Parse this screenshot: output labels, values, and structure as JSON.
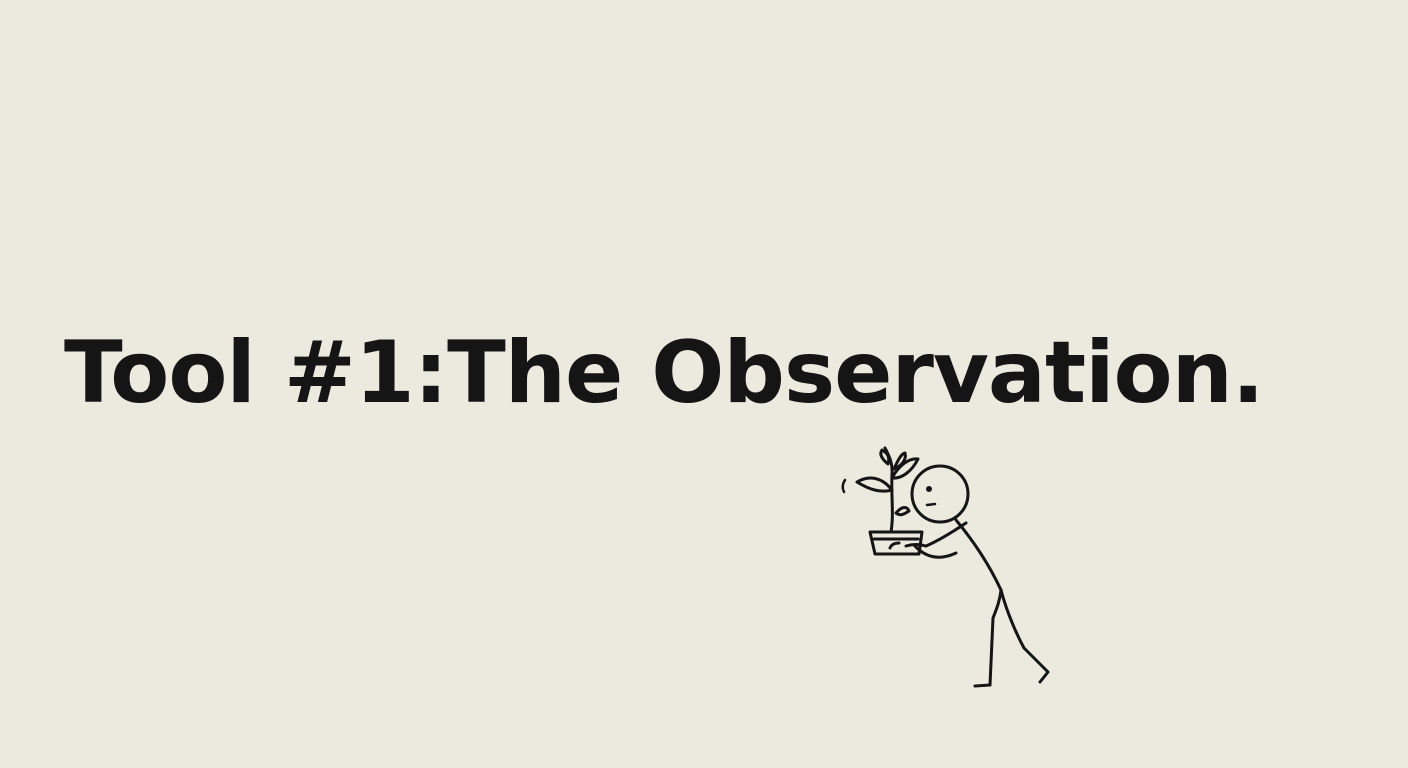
{
  "slide": {
    "title": "Tool #1:The Observation."
  },
  "illustration": {
    "subject": "stick figure holding potted plant"
  },
  "colors": {
    "background": "#ECE9DF",
    "ink": "#151515"
  }
}
